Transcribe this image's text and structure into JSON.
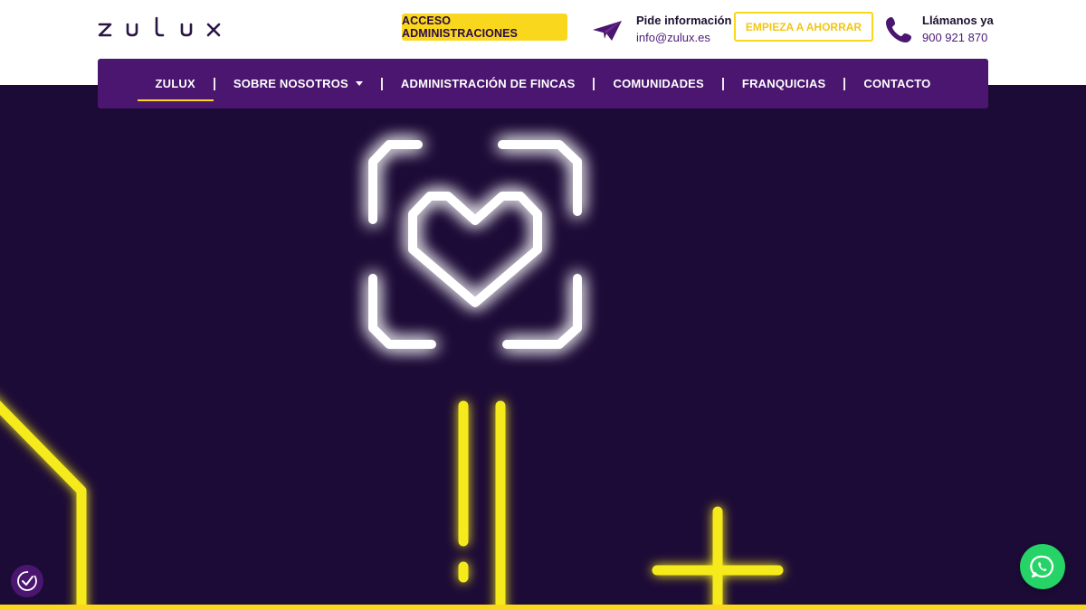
{
  "header": {
    "logo_text": "zulux",
    "admin_button": "ACCESO ADMINISTRACIONES",
    "info_title": "Pide información",
    "info_email": "info@zulux.es",
    "save_button": "EMPIEZA A AHORRAR",
    "call_title": "Llámanos ya",
    "call_number": "900 921 870"
  },
  "nav": {
    "items": [
      {
        "label": "ZULUX"
      },
      {
        "label": "SOBRE NOSOTROS"
      },
      {
        "label": "ADMINISTRACIÓN DE FINCAS"
      },
      {
        "label": "COMUNIDADES"
      },
      {
        "label": "FRANQUICIAS"
      },
      {
        "label": "CONTACTO"
      }
    ]
  },
  "colors": {
    "brand_purple": "#4a1670",
    "hero_bg": "#1d0b37",
    "accent_yellow": "#f9d71c",
    "whatsapp_green": "#25d366"
  },
  "icons": {
    "plane": "paper-plane-icon",
    "phone": "phone-icon",
    "accessibility": "accessibility-icon",
    "whatsapp": "whatsapp-icon",
    "neon_heart": "heart-frame-icon"
  }
}
